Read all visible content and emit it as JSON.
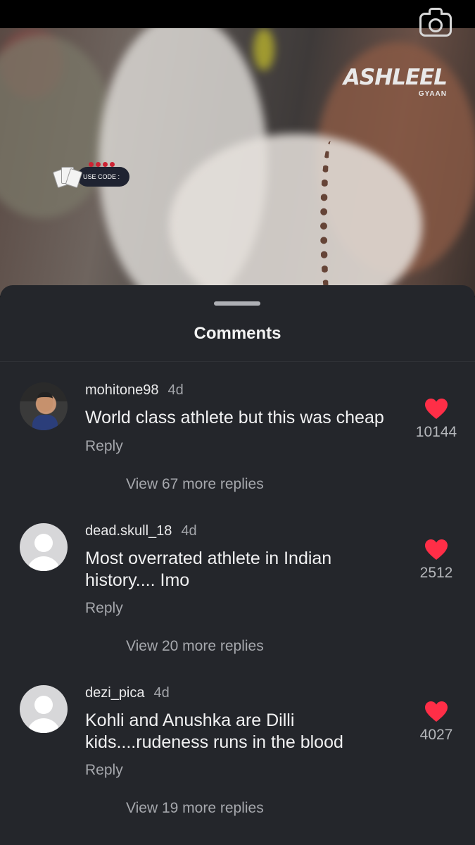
{
  "video": {
    "brand_name": "ASHLEEL",
    "brand_sub": "GYAAN",
    "promo_text": "USE CODE :"
  },
  "sheet": {
    "title": "Comments"
  },
  "comments": [
    {
      "username": "mohitone98",
      "time": "4d",
      "text": "World class athlete but this was cheap",
      "reply_label": "Reply",
      "likes": "10144",
      "view_replies": "View 67 more replies",
      "avatar": "photo"
    },
    {
      "username": "dead.skull_18",
      "time": "4d",
      "text": "Most overrated athlete in Indian history.... Imo",
      "reply_label": "Reply",
      "likes": "2512",
      "view_replies": "View 20 more replies",
      "avatar": "default"
    },
    {
      "username": "dezi_pica",
      "time": "4d",
      "text": "Kohli and Anushka are Dilli kids....rudeness runs in the blood",
      "reply_label": "Reply",
      "likes": "4027",
      "view_replies": "View 19 more replies",
      "avatar": "default"
    }
  ],
  "icons": {
    "camera": "camera-icon",
    "heart": "heart-icon",
    "avatar_placeholder": "default-avatar-icon"
  },
  "colors": {
    "sheet_background": "#24262b",
    "heart": "#ff2e47",
    "muted_text": "#a6a8ad"
  }
}
